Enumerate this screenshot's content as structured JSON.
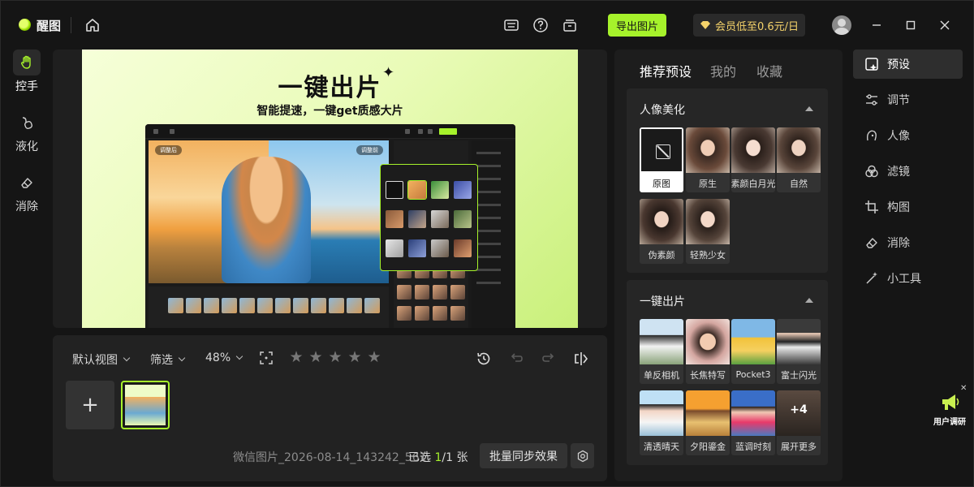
{
  "app": {
    "name": "醒图"
  },
  "titlebar": {
    "export_label": "导出图片",
    "vip_label": "会员低至0.6元/日",
    "icons": [
      "home-icon",
      "keyboard-icon",
      "help-icon",
      "archive-icon",
      "minimize-icon",
      "maximize-icon",
      "close-icon"
    ]
  },
  "left_tools": [
    {
      "id": "hand",
      "label": "控手",
      "active": true
    },
    {
      "id": "liquify",
      "label": "液化",
      "active": false
    },
    {
      "id": "erase",
      "label": "消除",
      "active": false
    }
  ],
  "canvas": {
    "poster_title": "一键出片",
    "poster_subtitle": "智能提速，一键get质感大片",
    "mock_tags": [
      "调整后",
      "调整前"
    ]
  },
  "bottom": {
    "view_label": "默认视图",
    "filter_label": "筛选",
    "zoom": "48%",
    "rating": 0,
    "rating_max": 5,
    "filename": "微信图片_2026-08-14_143242_561.",
    "selected_prefix": "已选 ",
    "selected_count": "1",
    "selected_suffix": "/1 张",
    "sync_label": "批量同步效果"
  },
  "presets": {
    "tabs": [
      {
        "label": "推荐预设",
        "active": true
      },
      {
        "label": "我的",
        "active": false
      },
      {
        "label": "收藏",
        "active": false
      }
    ],
    "sections": [
      {
        "title": "人像美化",
        "items": [
          "原图",
          "原生",
          "素颜白月光",
          "自然",
          "伪素颜",
          "轻熟少女"
        ]
      },
      {
        "title": "一键出片",
        "items": [
          "单反相机",
          "长焦特写",
          "Pocket3",
          "富士闪光",
          "清透晴天",
          "夕阳鎏金",
          "蓝调时刻",
          "展开更多"
        ],
        "more_count": "+4"
      }
    ]
  },
  "right_nav": [
    {
      "label": "预设",
      "icon": "preset-icon",
      "active": true
    },
    {
      "label": "调节",
      "icon": "sliders-icon",
      "active": false
    },
    {
      "label": "人像",
      "icon": "portrait-icon",
      "active": false
    },
    {
      "label": "滤镜",
      "icon": "filter-icon",
      "active": false
    },
    {
      "label": "构图",
      "icon": "crop-icon",
      "active": false
    },
    {
      "label": "消除",
      "icon": "eraser-icon",
      "active": false
    },
    {
      "label": "小工具",
      "icon": "magic-wand-icon",
      "active": false
    }
  ],
  "survey": {
    "label": "用户调研"
  },
  "colors": {
    "accent": "#a6f22b",
    "vip": "#f5d36a",
    "bg": "#151515",
    "panel": "#1d1d1d"
  }
}
